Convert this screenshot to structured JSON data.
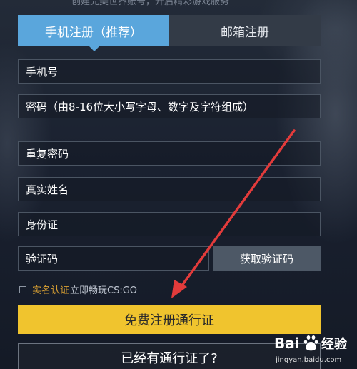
{
  "header": {
    "partial_text": "创建完美世界账号，开启精彩游戏服务"
  },
  "tabs": [
    {
      "label": "手机注册（推荐）",
      "active": true
    },
    {
      "label": "邮箱注册",
      "active": false
    }
  ],
  "form": {
    "phone_placeholder": "手机号",
    "password_placeholder": "密码（由8-16位大小写字母、数字及字符组成）",
    "repeat_password_placeholder": "重复密码",
    "real_name_placeholder": "真实姓名",
    "id_card_placeholder": "身份证",
    "code_placeholder": "验证码",
    "get_code_label": "获取验证码"
  },
  "agreement": {
    "checked": false,
    "link_label": "实名认证",
    "text": "立即畅玩CS:GO"
  },
  "actions": {
    "register_label": "免费注册通行证",
    "login_label": "已经有通行证了?"
  },
  "watermark": {
    "logo_text": "Bai 经验",
    "url": "jingyan.baidu.com"
  },
  "colors": {
    "tab_active": "#5aa6dc",
    "register_button": "#f0c42e",
    "annotation_arrow": "#e23b3b",
    "agreement_link": "#d9a033"
  }
}
